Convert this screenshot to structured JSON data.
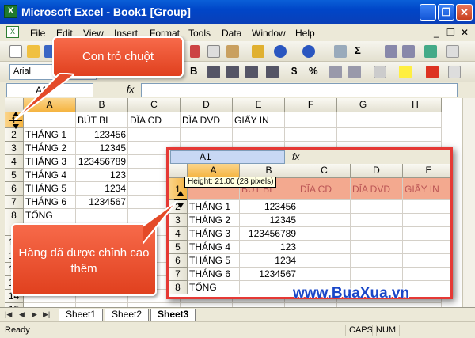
{
  "window": {
    "title": "Microsoft Excel - Book1  [Group]",
    "minimize": "_",
    "restore": "❐",
    "close": "✕"
  },
  "menu": {
    "items": [
      "File",
      "Edit",
      "View",
      "Insert",
      "Format",
      "Tools",
      "Data",
      "Window",
      "Help"
    ],
    "right_minimize": "_",
    "right_restore": "❐",
    "right_close": "✕"
  },
  "toolbar": {
    "font": "Arial",
    "bold": "B",
    "currency": "$",
    "percent": "%",
    "sigma": "Σ"
  },
  "formula_bar": {
    "name_box": "A1",
    "fx": "fx"
  },
  "columns": [
    "A",
    "B",
    "C",
    "D",
    "E",
    "F",
    "G",
    "H"
  ],
  "rows": [
    {
      "num": "1",
      "cells": [
        "",
        "BÚT BI",
        "DĨA CD",
        "DĨA DVD",
        "GIẤY IN"
      ]
    },
    {
      "num": "2",
      "cells": [
        "THÁNG 1",
        "123456",
        "",
        "",
        ""
      ]
    },
    {
      "num": "3",
      "cells": [
        "THÁNG 2",
        "12345",
        "",
        "",
        ""
      ]
    },
    {
      "num": "4",
      "cells": [
        "THÁNG 3",
        "123456789",
        "",
        "",
        ""
      ]
    },
    {
      "num": "5",
      "cells": [
        "THÁNG 4",
        "123",
        "",
        "",
        ""
      ]
    },
    {
      "num": "6",
      "cells": [
        "THÁNG 5",
        "1234",
        "",
        "",
        ""
      ]
    },
    {
      "num": "7",
      "cells": [
        "THÁNG 6",
        "1234567",
        "",
        "",
        ""
      ]
    },
    {
      "num": "8",
      "cells": [
        "TỔNG",
        "",
        "",
        "",
        ""
      ]
    }
  ],
  "extra_row_numbers": [
    "9",
    "10",
    "11",
    "12",
    "13",
    "14",
    "15",
    "16",
    "17",
    "18"
  ],
  "sheet_tabs": [
    "Sheet1",
    "Sheet2",
    "Sheet3"
  ],
  "status": {
    "ready": "Ready",
    "caps": "CAPS",
    "num": "NUM"
  },
  "callouts": {
    "cursor": "Con trỏ chuột",
    "row": "Hàng đã được chỉnh cao thêm"
  },
  "zoom": {
    "name_box": "A1",
    "fx": "fx",
    "tooltip": "Height: 21.00 (28 pixels)",
    "columns": [
      "A",
      "B",
      "C",
      "D",
      "E"
    ]
  },
  "watermark": "www.BuaXua.vn",
  "colors": {
    "accent_red": "#e53935",
    "title_blue": "#0a5fd8",
    "header_highlight": "#f5b441"
  }
}
